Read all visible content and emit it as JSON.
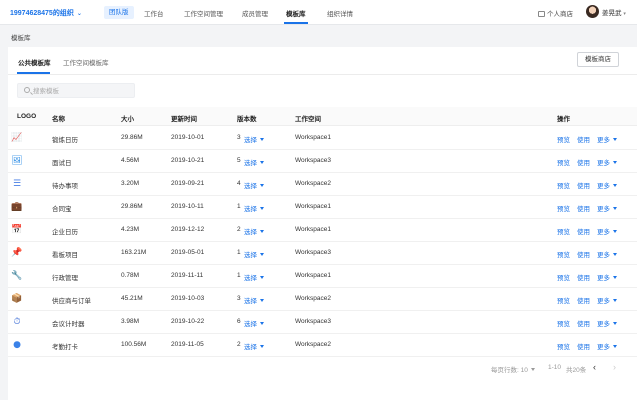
{
  "header": {
    "org_name": "19974628475的组织",
    "plan_badge": "团队版",
    "nav": [
      "工作台",
      "工作空间管理",
      "成员管理",
      "模板库",
      "组织详情"
    ],
    "active_nav": "模板库",
    "shop_link": "个人商店",
    "user_name": "姜晃武"
  },
  "breadcrumb": "模板库",
  "tabs": [
    "公共模板库",
    "工作空间模板库"
  ],
  "store_button": "模板商店",
  "search": {
    "placeholder": "搜索模板"
  },
  "table": {
    "columns": [
      "LOGO",
      "名称",
      "大小",
      "更新时间",
      "版本数",
      "工作空间",
      "操作"
    ],
    "select_label": "选择",
    "actions": [
      "预览",
      "使用",
      "更多"
    ],
    "rows": [
      {
        "icon": "chart-icon",
        "color": "#f1b632",
        "name": "锻炼日历",
        "size": "29.86M",
        "updated": "2019-10-01",
        "versions": "3",
        "workspace": "Workspace1"
      },
      {
        "icon": "photo-icon",
        "color": "#2e8ee6",
        "name": "面试日",
        "size": "4.56M",
        "updated": "2019-10-21",
        "versions": "5",
        "workspace": "Workspace3"
      },
      {
        "icon": "list-icon",
        "color": "#4a7fe6",
        "name": "待办事项",
        "size": "3.20M",
        "updated": "2019-09-21",
        "versions": "4",
        "workspace": "Workspace2"
      },
      {
        "icon": "briefcase-icon",
        "color": "#ef7e21",
        "name": "合同宝",
        "size": "29.86M",
        "updated": "2019-10-11",
        "versions": "1",
        "workspace": "Workspace1"
      },
      {
        "icon": "calendar-icon",
        "color": "#e3503a",
        "name": "企业日历",
        "size": "4.23M",
        "updated": "2019-12-12",
        "versions": "2",
        "workspace": "Workspace1"
      },
      {
        "icon": "pin-icon",
        "color": "#e23b3b",
        "name": "看板项目",
        "size": "163.21M",
        "updated": "2019-05-01",
        "versions": "1",
        "workspace": "Workspace3"
      },
      {
        "icon": "wrench-icon",
        "color": "#5f6d80",
        "name": "行政管理",
        "size": "0.78M",
        "updated": "2019-11-11",
        "versions": "1",
        "workspace": "Workspace1"
      },
      {
        "icon": "box-icon",
        "color": "#f0a52a",
        "name": "供应商与订单",
        "size": "45.21M",
        "updated": "2019-10-03",
        "versions": "3",
        "workspace": "Workspace2"
      },
      {
        "icon": "stopwatch-icon",
        "color": "#3f6fd6",
        "name": "会议计时器",
        "size": "3.98M",
        "updated": "2019-10-22",
        "versions": "6",
        "workspace": "Workspace3"
      },
      {
        "icon": "circle-icon",
        "color": "#3b82e8",
        "name": "考勤打卡",
        "size": "100.56M",
        "updated": "2019-11-05",
        "versions": "2",
        "workspace": "Workspace2"
      }
    ]
  },
  "pagination": {
    "page_size_label": "每页行数: 10",
    "range": "1-10",
    "total": "共20条"
  },
  "colors": {
    "accent": "#1a73e8",
    "link": "#1a73e8"
  }
}
